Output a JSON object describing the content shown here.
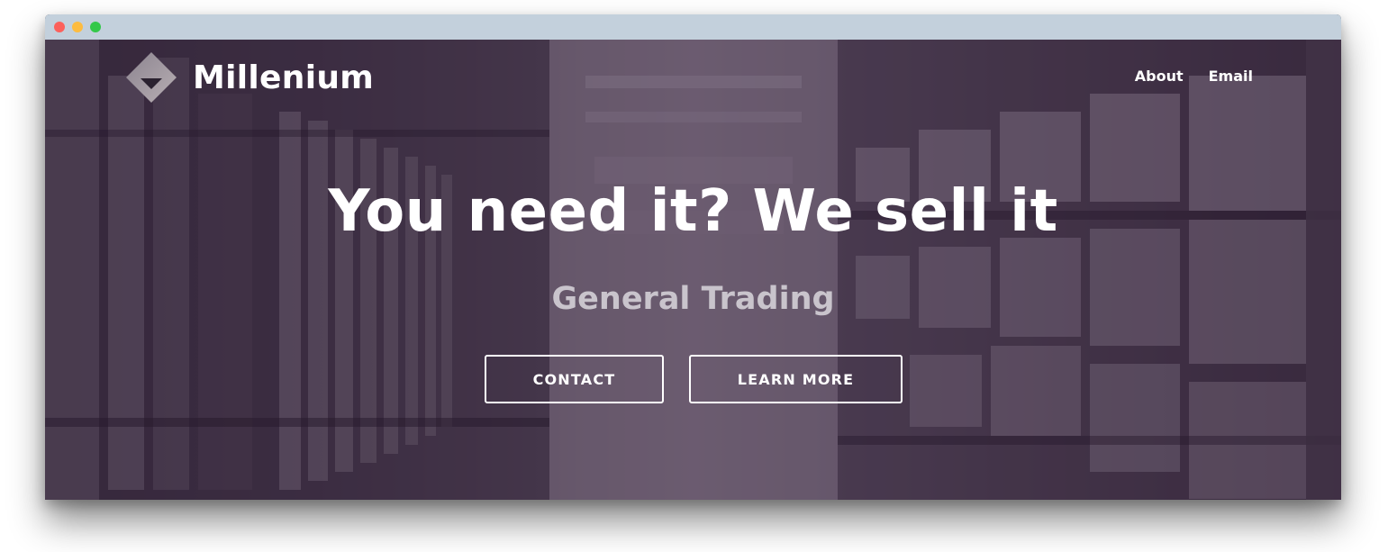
{
  "brand": {
    "name": "Millenium",
    "logo_icon": "diamond-logo-icon"
  },
  "nav": {
    "items": [
      "About",
      "Email"
    ]
  },
  "hero": {
    "headline": "You need it? We sell it",
    "subheadline": "General Trading",
    "buttons": {
      "contact": "CONTACT",
      "learn_more": "LEARN MORE"
    },
    "background": "warehouse-shelves-photo"
  },
  "colors": {
    "overlay_tint": "#3c2646",
    "text": "#ffffff",
    "subheadline_text": "#c9c4cc",
    "titlebar": "#c3d0dc"
  }
}
